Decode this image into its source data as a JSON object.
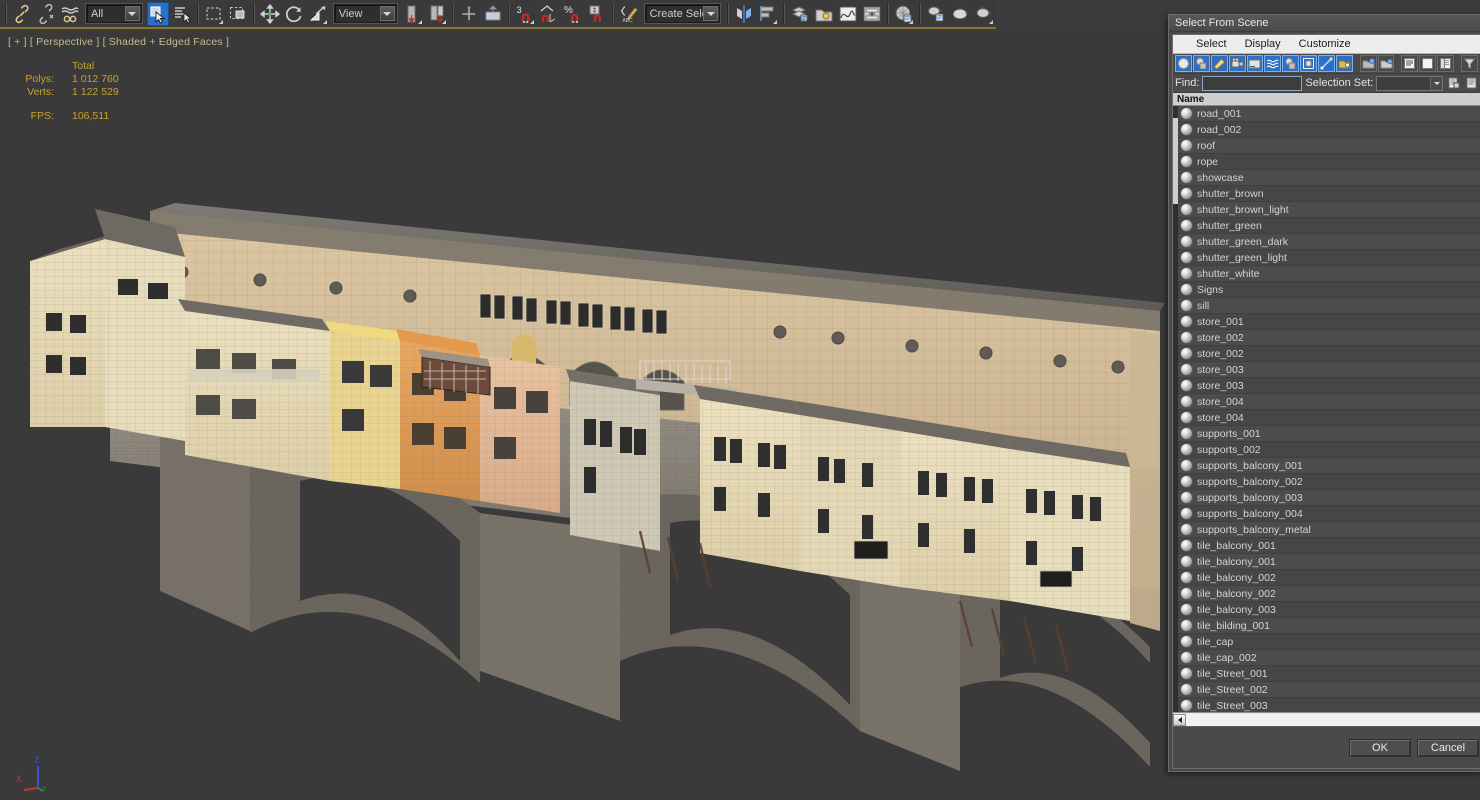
{
  "app": {
    "toolbar": {
      "filter_combo_value": "All",
      "ref_coord_combo_value": "View",
      "selection_set_combo_value": "Create Selection Se",
      "angle_snap_value": "3",
      "percent_snap_label": "%",
      "buttons": [
        {
          "name": "select-link-button",
          "icon": "link-icon"
        },
        {
          "name": "unlink-button",
          "icon": "unlink-icon"
        },
        {
          "name": "bind-space-warp-button",
          "icon": "bind-warp-icon"
        },
        {
          "name": "select-object-button",
          "icon": "select-object-icon",
          "active": true
        },
        {
          "name": "select-by-name-button",
          "icon": "select-by-name-icon"
        },
        {
          "name": "rectangular-selection-region-button",
          "icon": "rect-region-icon"
        },
        {
          "name": "window-crossing-button",
          "icon": "window-crossing-icon"
        },
        {
          "name": "select-and-move-button",
          "icon": "move-gizmo-icon"
        },
        {
          "name": "select-and-rotate-button",
          "icon": "rotate-gizmo-icon"
        },
        {
          "name": "select-and-scale-button",
          "icon": "scale-gizmo-icon"
        },
        {
          "name": "use-pivot-center-button",
          "icon": "pivot-center-icon"
        },
        {
          "name": "select-and-manipulate-button",
          "icon": "manipulate-icon"
        },
        {
          "name": "snaps-toggle-button",
          "icon": "snap-magnet-icon"
        },
        {
          "name": "angle-snap-button",
          "icon": "angle-snap-icon"
        },
        {
          "name": "percent-snap-button",
          "icon": "percent-snap-icon"
        },
        {
          "name": "spinner-snap-button",
          "icon": "spinner-snap-icon"
        },
        {
          "name": "named-selection-sets-button",
          "icon": "named-sets-icon"
        },
        {
          "name": "mirror-button",
          "icon": "mirror-icon"
        },
        {
          "name": "align-button",
          "icon": "align-icon"
        },
        {
          "name": "layer-explorer-button",
          "icon": "layers-icon"
        },
        {
          "name": "scene-explorer-button",
          "icon": "scene-explorer-icon"
        },
        {
          "name": "curve-editor-button",
          "icon": "curve-editor-icon"
        },
        {
          "name": "schematic-view-button",
          "icon": "schematic-view-icon"
        },
        {
          "name": "material-editor-button",
          "icon": "material-editor-icon"
        },
        {
          "name": "render-setup-button",
          "icon": "render-setup-icon"
        },
        {
          "name": "rendered-frame-window-button",
          "icon": "render-frame-icon"
        },
        {
          "name": "render-production-button",
          "icon": "render-teapot-icon"
        }
      ]
    },
    "viewport": {
      "label": "[ + ] [ Perspective ] [ Shaded + Edged Faces ]",
      "stats": {
        "total_header": "Total",
        "polys_label": "Polys:",
        "polys_value": "1 012 760",
        "verts_label": "Verts:",
        "verts_value": "1 122 529",
        "fps_label": "FPS:",
        "fps_value": "106,511"
      },
      "axis": {
        "x": "X",
        "y": "Y",
        "z": "Z"
      }
    }
  },
  "dialog": {
    "title": "Select From Scene",
    "menu": [
      "Select",
      "Display",
      "Customize"
    ],
    "tools": [
      {
        "name": "display-geometry-toggle",
        "icon": "sphere-icon",
        "on": true
      },
      {
        "name": "display-shapes-toggle",
        "icon": "shapes-icon",
        "on": true
      },
      {
        "name": "display-lights-toggle",
        "icon": "light-icon",
        "on": true
      },
      {
        "name": "display-cameras-toggle",
        "icon": "camera-icon",
        "on": true
      },
      {
        "name": "display-helpers-toggle",
        "icon": "helper-icon",
        "on": true
      },
      {
        "name": "display-space-warps-toggle",
        "icon": "space-warp-icon",
        "on": true
      },
      {
        "name": "display-groups-toggle",
        "icon": "groups-icon",
        "on": true
      },
      {
        "name": "display-xrefs-toggle",
        "icon": "xref-icon",
        "on": true
      },
      {
        "name": "display-bones-toggle",
        "icon": "bone-icon",
        "on": true
      },
      {
        "name": "display-containers-toggle",
        "icon": "container-icon",
        "on": true
      },
      {
        "name": "select-children-button",
        "icon": "select-children-icon",
        "on": false
      },
      {
        "name": "select-influences-button",
        "icon": "select-influences-icon",
        "on": false
      },
      {
        "name": "list-types-button",
        "icon": "list-view-icon",
        "on": false
      },
      {
        "name": "sort-flat-button",
        "icon": "flat-list-icon",
        "on": false
      },
      {
        "name": "sort-hierarchy-button",
        "icon": "hierarchy-list-icon",
        "on": false
      },
      {
        "name": "filter-button",
        "icon": "funnel-icon",
        "on": false
      }
    ],
    "find": {
      "label": "Find:",
      "value": "",
      "placeholder": ""
    },
    "selection_set": {
      "label": "Selection Set:",
      "value": "",
      "placeholder": ""
    },
    "sidebar_icons": [
      {
        "name": "save-selection-set-icon",
        "icon": "save-set-icon"
      },
      {
        "name": "delete-selection-set-icon",
        "icon": "delete-set-icon"
      }
    ],
    "list": {
      "header": "Name",
      "items": [
        "road_001",
        "road_002",
        "roof",
        "rope",
        "showcase",
        "shutter_brown",
        "shutter_brown_light",
        "shutter_green",
        "shutter_green_dark",
        "shutter_green_light",
        "shutter_white",
        "Signs",
        "sill",
        "store_001",
        "store_002",
        "store_002",
        "store_003",
        "store_003",
        "store_004",
        "store_004",
        "supports_001",
        "supports_002",
        "supports_balcony_001",
        "supports_balcony_002",
        "supports_balcony_003",
        "supports_balcony_004",
        "supports_balcony_metal",
        "tile_balcony_001",
        "tile_balcony_001",
        "tile_balcony_002",
        "tile_balcony_002",
        "tile_balcony_003",
        "tile_bilding_001",
        "tile_cap",
        "tile_cap_002",
        "tile_Street_001",
        "tile_Street_002",
        "tile_Street_003"
      ]
    },
    "footer": {
      "ok_label": "OK",
      "cancel_label": "Cancel"
    }
  },
  "colors": {
    "accent_blue": "#2a6fc9",
    "stats_yellow": "#c9a227",
    "viewport_bg": "#3a3a3a",
    "dialog_bg": "#4a4a4a",
    "toolbar_rule": "#8a7430"
  }
}
